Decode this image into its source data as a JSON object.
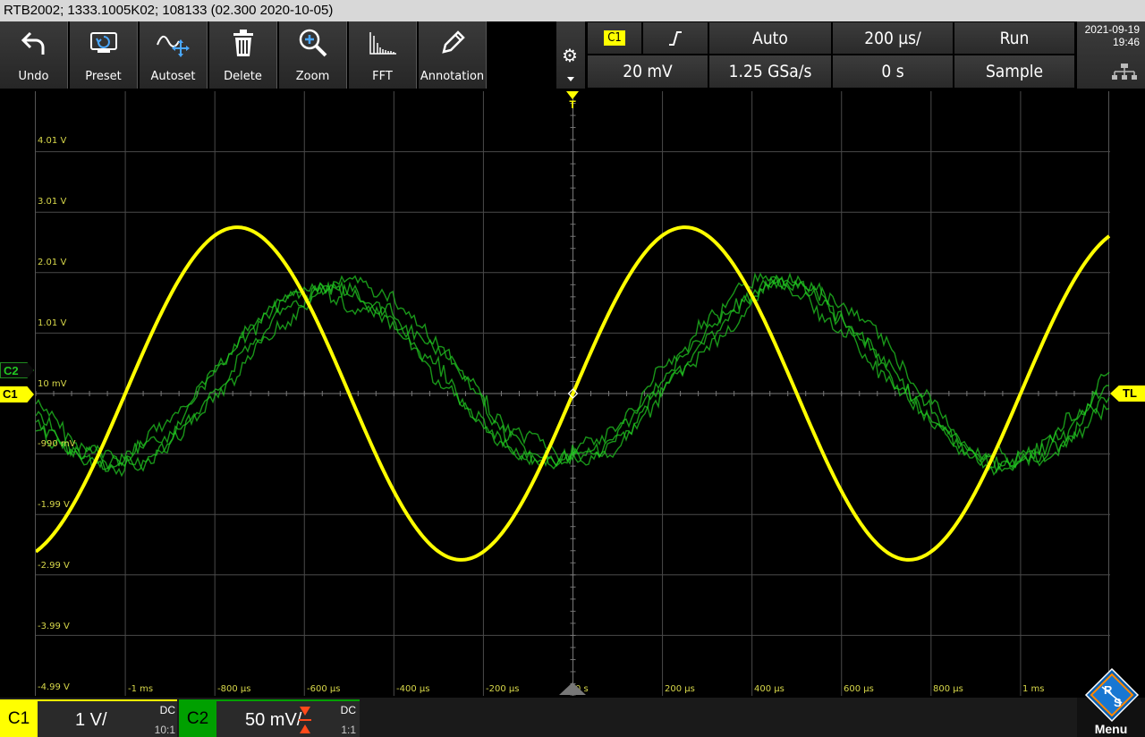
{
  "title": "RTB2002; 1333.1005K02; 108133 (02.300 2020-10-05)",
  "toolbar": [
    {
      "label": "Undo",
      "icon": "undo-icon"
    },
    {
      "label": "Preset",
      "icon": "preset-icon"
    },
    {
      "label": "Autoset",
      "icon": "autoset-icon"
    },
    {
      "label": "Delete",
      "icon": "delete-icon"
    },
    {
      "label": "Zoom",
      "icon": "zoom-icon"
    },
    {
      "label": "FFT",
      "icon": "fft-icon"
    },
    {
      "label": "Annotation",
      "icon": "annotation-icon"
    }
  ],
  "trigger": {
    "source": "C1",
    "slope_icon": "rising-edge-icon",
    "level": "20 mV",
    "mode": "Auto",
    "sample_rate": "1.25 GSa/s",
    "time_scale": "200 µs/",
    "position": "0 s",
    "run_state": "Run",
    "acq_mode": "Sample"
  },
  "clock": {
    "date": "2021-09-19",
    "time": "19:46"
  },
  "y_labels": [
    "4.01 V",
    "3.01 V",
    "2.01 V",
    "1.01 V",
    "10 mV",
    "-990 mV",
    "-1.99 V",
    "-2.99 V",
    "-3.99 V",
    "-4.99 V"
  ],
  "x_labels": [
    "-1 ms",
    "-800 µs",
    "-600 µs",
    "-400 µs",
    "-200 µs",
    "0 s",
    "200 µs",
    "400 µs",
    "600 µs",
    "800 µs",
    "1 ms"
  ],
  "markers": {
    "c1": "C1",
    "c2": "C2",
    "trigger_level": "TL",
    "trigger_pos": "T"
  },
  "channels": [
    {
      "name": "C1",
      "scale": "1 V/",
      "coupling": "DC",
      "probe": "10:1",
      "color": "#ffff00"
    },
    {
      "name": "C2",
      "scale": "50 mV/",
      "coupling": "DC",
      "probe": "1:1",
      "color": "#00a000"
    }
  ],
  "logo": {
    "text": "R&S",
    "menu": "Menu"
  },
  "colors": {
    "ch1": "#ffff00",
    "ch2": "#22c822",
    "grid": "#4a4a4a"
  }
}
